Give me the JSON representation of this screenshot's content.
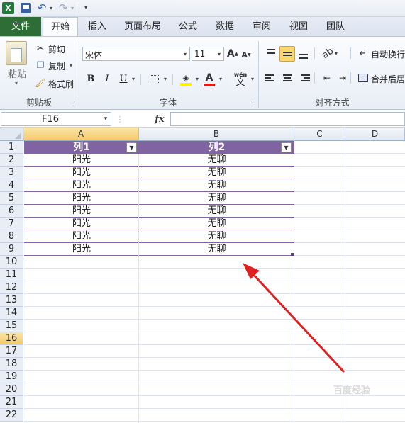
{
  "quick_access": {
    "icons": [
      "excel-logo-icon",
      "save-icon",
      "undo-icon",
      "redo-icon",
      "customize-icon"
    ]
  },
  "tabs": [
    "文件",
    "开始",
    "插入",
    "页面布局",
    "公式",
    "数据",
    "审阅",
    "视图",
    "团队"
  ],
  "ribbon": {
    "clipboard": {
      "paste": "粘贴",
      "cut": "剪切",
      "copy": "复制",
      "format_painter": "格式刷",
      "group": "剪贴板"
    },
    "font": {
      "name": "宋体",
      "size": "11",
      "bold": "B",
      "italic": "I",
      "underline": "U",
      "font_color": "A",
      "phonetic": "wén",
      "phonetic_sub": "文",
      "group": "字体"
    },
    "alignment": {
      "wrap": "自动换行",
      "merge": "合并后居",
      "group": "对齐方式"
    }
  },
  "formula_bar": {
    "name_box": "F16",
    "fx": "fx",
    "value": ""
  },
  "columns": [
    "A",
    "B",
    "C",
    "D"
  ],
  "rows": [
    "1",
    "2",
    "3",
    "4",
    "5",
    "6",
    "7",
    "8",
    "9",
    "10",
    "11",
    "12",
    "13",
    "14",
    "15",
    "16",
    "17",
    "18",
    "19",
    "20",
    "21",
    "22"
  ],
  "table": {
    "headers": [
      "列1",
      "列2"
    ],
    "body": [
      [
        "阳光",
        "无聊"
      ],
      [
        "阳光",
        "无聊"
      ],
      [
        "阳光",
        "无聊"
      ],
      [
        "阳光",
        "无聊"
      ],
      [
        "阳光",
        "无聊"
      ],
      [
        "阳光",
        "无聊"
      ],
      [
        "阳光",
        "无聊"
      ],
      [
        "阳光",
        "无聊"
      ]
    ]
  },
  "colors": {
    "header_fill": "#8064a2",
    "band_border": "#8064a2",
    "arrow": "#e02020",
    "active_row": "#f9d86a"
  },
  "watermark": "百度经验"
}
